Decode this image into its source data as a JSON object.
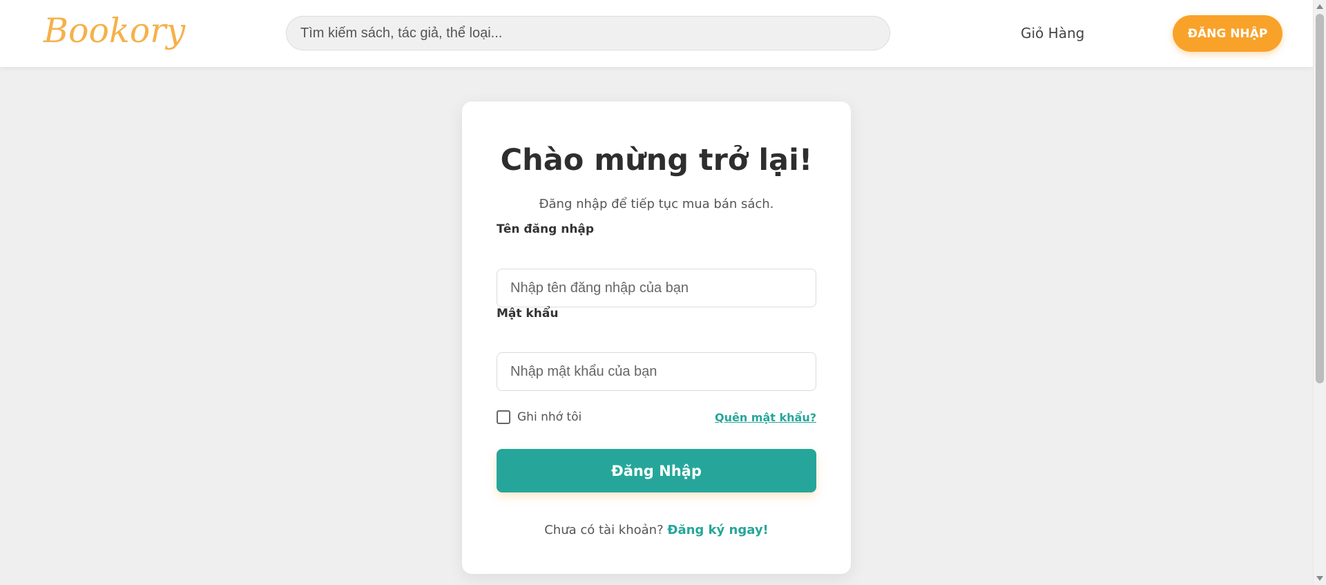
{
  "header": {
    "logo_text": "Bookory",
    "search_placeholder": "Tìm kiếm sách, tác giả, thể loại...",
    "cart_label": "Giỏ Hàng",
    "login_button_label": "ĐĂNG NHẬP"
  },
  "login_form": {
    "title": "Chào mừng trở lại!",
    "subtitle": "Đăng nhập để tiếp tục mua bán sách.",
    "username_label": "Tên đăng nhập",
    "username_placeholder": "Nhập tên đăng nhập của bạn",
    "password_label": "Mật khẩu",
    "password_placeholder": "Nhập mật khẩu của bạn",
    "remember_label": "Ghi nhớ tôi",
    "remember_checked": false,
    "forgot_link": "Quên mật khẩu?",
    "submit_label": "Đăng Nhập",
    "signup_prompt": "Chưa có tài khoản?",
    "signup_link": "Đăng ký ngay!"
  },
  "colors": {
    "brand": "#f5b14a",
    "accent": "#26a69a",
    "primary_button": "#f9a22a",
    "page_background": "#efefef"
  }
}
